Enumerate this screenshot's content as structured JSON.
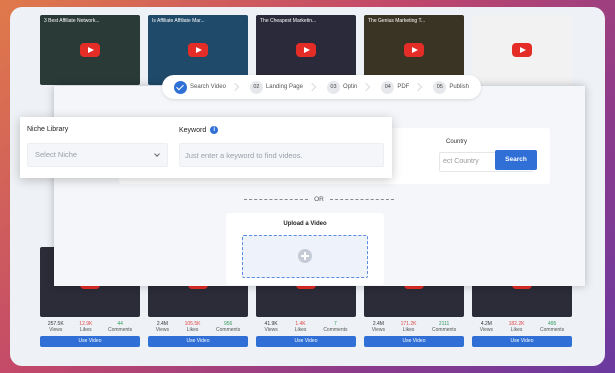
{
  "background_grid": {
    "row1": [
      {
        "title": "3 Best Affiliate Network...",
        "thumb_color": "#2a3a36"
      },
      {
        "title": "Is Affiliate Affiliate Mar...",
        "thumb_color": "#1f4a6a"
      },
      {
        "title": "The Cheapest Marketin...",
        "thumb_color": "#2a2a3a"
      },
      {
        "title": "The Genius Marketing T...",
        "thumb_color": "#3a3424"
      },
      {
        "title": "",
        "thumb_color": "#f2f2f2"
      }
    ],
    "row2": [
      {
        "views": "257.5K",
        "likes": "12.9K",
        "comments": "44"
      },
      {
        "views": "2.4M",
        "likes": "105.5K",
        "comments": "956"
      },
      {
        "views": "41.9K",
        "likes": "1.4K",
        "comments": "7"
      },
      {
        "views": "2.4M",
        "likes": "171.2K",
        "comments": "2111"
      },
      {
        "views": "4.2M",
        "likes": "182.2K",
        "comments": "495"
      }
    ],
    "views_label": "Views",
    "likes_label": "Likes",
    "comments_label": "Comments",
    "use_video_label": "Use Video"
  },
  "stepper": [
    {
      "num": "",
      "label": "Search Video",
      "done": true
    },
    {
      "num": "02",
      "label": "Landing Page"
    },
    {
      "num": "03",
      "label": "Optin"
    },
    {
      "num": "04",
      "label": "PDF"
    },
    {
      "num": "05",
      "label": "Publish"
    }
  ],
  "search": {
    "country_label": "Country",
    "country_placeholder": "ect Country",
    "button": "Search"
  },
  "or_label": "OR",
  "upload": {
    "title": "Upload a Video"
  },
  "niche": {
    "label": "Niche Library",
    "placeholder": "Select Niche"
  },
  "keyword": {
    "label": "Keyword",
    "info": "i",
    "placeholder": "Just enter a keyword to find videos."
  },
  "colors": {
    "accent": "#2f6fd6",
    "youtube_red": "#e52d27"
  }
}
